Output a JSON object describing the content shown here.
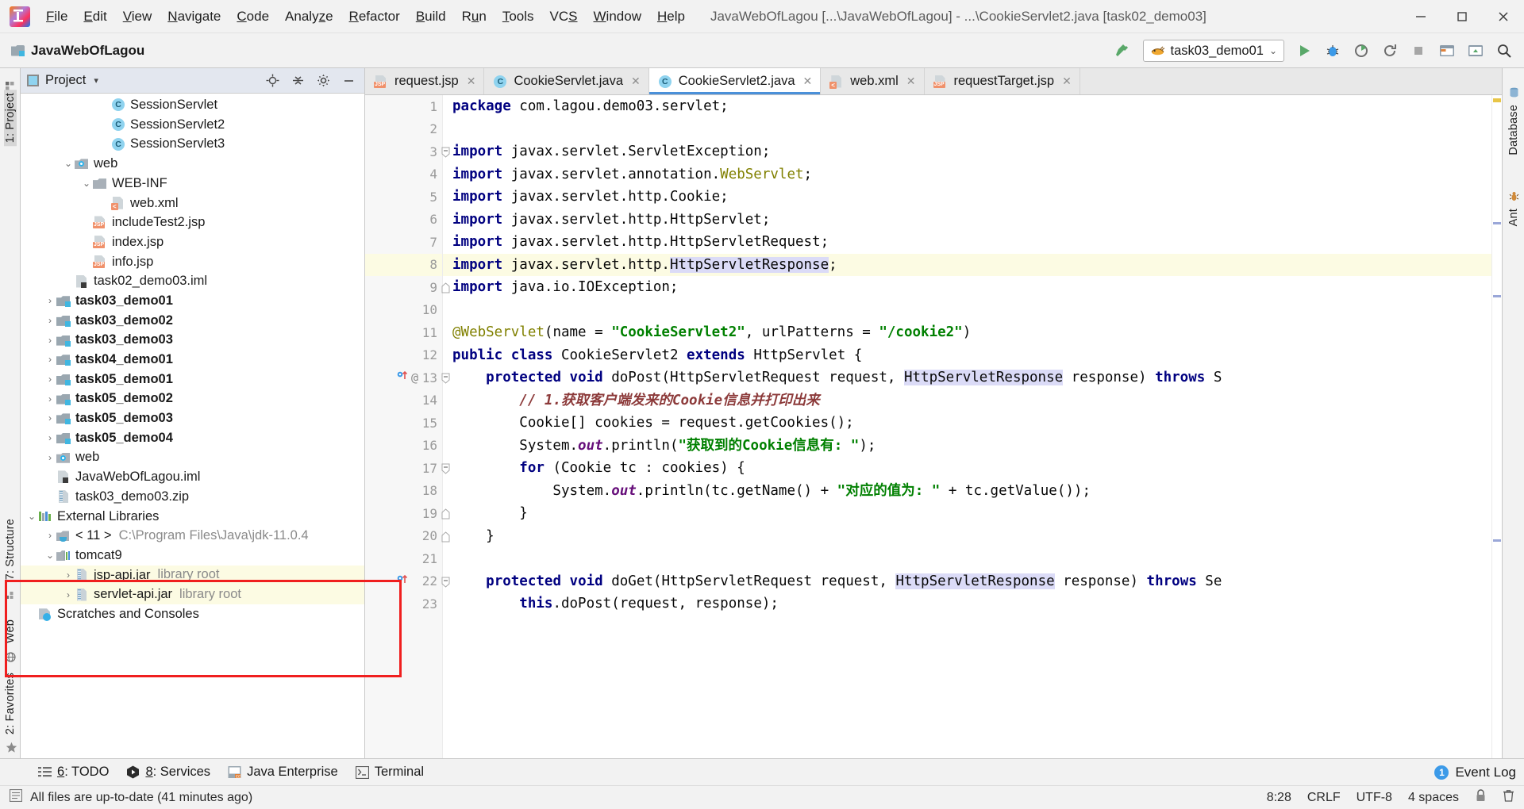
{
  "window": {
    "app_icon": "intellij-idea-logo",
    "title": "JavaWebOfLagou [...\\JavaWebOfLagou] - ...\\CookieServlet2.java [task02_demo03]",
    "minimize": "—",
    "maximize": "▢",
    "close": "✕"
  },
  "menubar": {
    "items": [
      {
        "label": "File",
        "mnemonic": "F"
      },
      {
        "label": "Edit",
        "mnemonic": "E"
      },
      {
        "label": "View",
        "mnemonic": "V"
      },
      {
        "label": "Navigate",
        "mnemonic": "N"
      },
      {
        "label": "Code",
        "mnemonic": "C"
      },
      {
        "label": "Analyze",
        "mnemonic": "z"
      },
      {
        "label": "Refactor",
        "mnemonic": "R"
      },
      {
        "label": "Build",
        "mnemonic": "B"
      },
      {
        "label": "Run",
        "mnemonic": "u"
      },
      {
        "label": "Tools",
        "mnemonic": "T"
      },
      {
        "label": "VCS",
        "mnemonic": "S"
      },
      {
        "label": "Window",
        "mnemonic": "W"
      },
      {
        "label": "Help",
        "mnemonic": "H"
      }
    ]
  },
  "navbar": {
    "breadcrumb": "JavaWebOfLagou",
    "run_config": {
      "label": "task03_demo01",
      "icon": "tomcat-icon",
      "chevron": "⌄"
    },
    "buttons": [
      {
        "name": "build-hammer",
        "icon": "hammer-icon"
      },
      {
        "name": "run",
        "icon": "run-triangle-icon"
      },
      {
        "name": "debug",
        "icon": "debug-bug-icon"
      },
      {
        "name": "run-coverage",
        "icon": "coverage-icon"
      },
      {
        "name": "rerun",
        "icon": "rerun-icon"
      },
      {
        "name": "stop",
        "icon": "stop-square-icon"
      },
      {
        "name": "open-in-browser",
        "icon": "browser-icon"
      },
      {
        "name": "update-app",
        "icon": "update-icon"
      },
      {
        "name": "search-everywhere",
        "icon": "search-icon"
      }
    ]
  },
  "left_rail": {
    "items": [
      "1: Project",
      "7: Structure",
      "Web",
      "2: Favorites"
    ],
    "active": "1: Project",
    "favorites_star": "★"
  },
  "right_rail": {
    "items": [
      "Database",
      "Ant"
    ]
  },
  "project_panel": {
    "title": "Project",
    "title_chevron": "▾",
    "header_buttons": [
      {
        "name": "locate-file-icon",
        "glyph": "⊕"
      },
      {
        "name": "collapse-all-icon",
        "glyph": "⇥"
      },
      {
        "name": "settings-gear-icon",
        "glyph": "⚙"
      },
      {
        "name": "hide-panel-icon",
        "glyph": "—"
      }
    ],
    "tree": [
      {
        "indent": 4,
        "arrow": "",
        "icon": "java-class-icon",
        "label": "SessionServlet",
        "sub": "",
        "bold": false,
        "highlight": false
      },
      {
        "indent": 4,
        "arrow": "",
        "icon": "java-class-icon",
        "label": "SessionServlet2",
        "sub": "",
        "bold": false,
        "highlight": false
      },
      {
        "indent": 4,
        "arrow": "",
        "icon": "java-class-icon",
        "label": "SessionServlet3",
        "sub": "",
        "bold": false,
        "highlight": false
      },
      {
        "indent": 2,
        "arrow": "⌄",
        "icon": "web-folder-icon",
        "label": "web",
        "sub": "",
        "bold": false,
        "highlight": false
      },
      {
        "indent": 3,
        "arrow": "⌄",
        "icon": "folder-icon",
        "label": "WEB-INF",
        "sub": "",
        "bold": false,
        "highlight": false
      },
      {
        "indent": 4,
        "arrow": "",
        "icon": "xml-file-icon",
        "label": "web.xml",
        "sub": "",
        "bold": false,
        "highlight": false
      },
      {
        "indent": 3,
        "arrow": "",
        "icon": "jsp-file-icon",
        "label": "includeTest2.jsp",
        "sub": "",
        "bold": false,
        "highlight": false
      },
      {
        "indent": 3,
        "arrow": "",
        "icon": "jsp-file-icon",
        "label": "index.jsp",
        "sub": "",
        "bold": false,
        "highlight": false
      },
      {
        "indent": 3,
        "arrow": "",
        "icon": "jsp-file-icon",
        "label": "info.jsp",
        "sub": "",
        "bold": false,
        "highlight": false
      },
      {
        "indent": 2,
        "arrow": "",
        "icon": "iml-file-icon",
        "label": "task02_demo03.iml",
        "sub": "",
        "bold": false,
        "highlight": false
      },
      {
        "indent": 1,
        "arrow": "›",
        "icon": "module-folder-icon",
        "label": "task03_demo01",
        "sub": "",
        "bold": true,
        "highlight": false
      },
      {
        "indent": 1,
        "arrow": "›",
        "icon": "module-folder-icon",
        "label": "task03_demo02",
        "sub": "",
        "bold": true,
        "highlight": false
      },
      {
        "indent": 1,
        "arrow": "›",
        "icon": "module-folder-icon",
        "label": "task03_demo03",
        "sub": "",
        "bold": true,
        "highlight": false
      },
      {
        "indent": 1,
        "arrow": "›",
        "icon": "module-folder-icon",
        "label": "task04_demo01",
        "sub": "",
        "bold": true,
        "highlight": false
      },
      {
        "indent": 1,
        "arrow": "›",
        "icon": "module-folder-icon",
        "label": "task05_demo01",
        "sub": "",
        "bold": true,
        "highlight": false
      },
      {
        "indent": 1,
        "arrow": "›",
        "icon": "module-folder-icon",
        "label": "task05_demo02",
        "sub": "",
        "bold": true,
        "highlight": false
      },
      {
        "indent": 1,
        "arrow": "›",
        "icon": "module-folder-icon",
        "label": "task05_demo03",
        "sub": "",
        "bold": true,
        "highlight": false
      },
      {
        "indent": 1,
        "arrow": "›",
        "icon": "module-folder-icon",
        "label": "task05_demo04",
        "sub": "",
        "bold": true,
        "highlight": false
      },
      {
        "indent": 1,
        "arrow": "›",
        "icon": "web-folder-icon",
        "label": "web",
        "sub": "",
        "bold": false,
        "highlight": false
      },
      {
        "indent": 1,
        "arrow": "",
        "icon": "iml-file-icon",
        "label": "JavaWebOfLagou.iml",
        "sub": "",
        "bold": false,
        "highlight": false
      },
      {
        "indent": 1,
        "arrow": "",
        "icon": "zip-file-icon",
        "label": "task03_demo03.zip",
        "sub": "",
        "bold": false,
        "highlight": false
      },
      {
        "indent": 0,
        "arrow": "⌄",
        "icon": "external-libraries-icon",
        "label": "External Libraries",
        "sub": "",
        "bold": false,
        "highlight": false
      },
      {
        "indent": 1,
        "arrow": "›",
        "icon": "jdk-icon",
        "label": "< 11 >",
        "sub": "C:\\Program Files\\Java\\jdk-11.0.4",
        "bold": false,
        "highlight": false
      },
      {
        "indent": 1,
        "arrow": "⌄",
        "icon": "library-icon",
        "label": "tomcat9",
        "sub": "",
        "bold": false,
        "highlight": false
      },
      {
        "indent": 2,
        "arrow": "›",
        "icon": "jar-file-icon",
        "label": "jsp-api.jar",
        "sub": "library root",
        "bold": false,
        "highlight": true
      },
      {
        "indent": 2,
        "arrow": "›",
        "icon": "jar-file-icon",
        "label": "servlet-api.jar",
        "sub": "library root",
        "bold": false,
        "highlight": true
      },
      {
        "indent": 0,
        "arrow": "",
        "icon": "scratches-icon",
        "label": "Scratches and Consoles",
        "sub": "",
        "bold": false,
        "highlight": false
      }
    ],
    "annotation": {
      "name": "red-highlight-box",
      "color": "#f01f1f"
    }
  },
  "editor": {
    "tabs": [
      {
        "label": "request.jsp",
        "icon": "jsp-file-icon",
        "active": false,
        "close": "✕"
      },
      {
        "label": "CookieServlet.java",
        "icon": "java-class-icon",
        "active": false,
        "close": "✕"
      },
      {
        "label": "CookieServlet2.java",
        "icon": "java-class-icon",
        "active": true,
        "close": "✕"
      },
      {
        "label": "web.xml",
        "icon": "xml-file-icon",
        "active": false,
        "close": "✕"
      },
      {
        "label": "requestTarget.jsp",
        "icon": "jsp-file-icon",
        "active": false,
        "close": "✕"
      }
    ],
    "lines": [
      {
        "n": 1,
        "html": "<span class='kw'>package</span> com.lagou.demo03.servlet;",
        "fold": false,
        "hl": false,
        "gutter_icons": ""
      },
      {
        "n": 2,
        "html": "",
        "fold": false,
        "hl": false,
        "gutter_icons": ""
      },
      {
        "n": 3,
        "html": "<span class='kw'>import</span> javax.servlet.ServletException;",
        "fold": "top",
        "hl": false,
        "gutter_icons": ""
      },
      {
        "n": 4,
        "html": "<span class='kw'>import</span> javax.servlet.annotation.<span class='ann'>WebServlet</span>;",
        "fold": false,
        "hl": false,
        "gutter_icons": ""
      },
      {
        "n": 5,
        "html": "<span class='kw'>import</span> javax.servlet.http.Cookie;",
        "fold": false,
        "hl": false,
        "gutter_icons": ""
      },
      {
        "n": 6,
        "html": "<span class='kw'>import</span> javax.servlet.http.HttpServlet;",
        "fold": false,
        "hl": false,
        "gutter_icons": ""
      },
      {
        "n": 7,
        "html": "<span class='kw'>import</span> javax.servlet.http.HttpServletRequest;",
        "fold": false,
        "hl": false,
        "gutter_icons": ""
      },
      {
        "n": 8,
        "html": "<span class='kw'>import</span> javax.servlet.http.<span class='hlid'>HttpServletResponse</span>;",
        "fold": false,
        "hl": true,
        "gutter_icons": ""
      },
      {
        "n": 9,
        "html": "<span class='kw'>import</span> java.io.IOException;",
        "fold": "bottom",
        "hl": false,
        "gutter_icons": ""
      },
      {
        "n": 10,
        "html": "",
        "fold": false,
        "hl": false,
        "gutter_icons": ""
      },
      {
        "n": 11,
        "html": "<span class='ann'>@WebServlet</span>(name = <span class='str'>\"CookieServlet2\"</span>, urlPatterns = <span class='str'>\"/cookie2\"</span>)",
        "fold": false,
        "hl": false,
        "gutter_icons": ""
      },
      {
        "n": 12,
        "html": "<span class='kw'>public</span> <span class='kw'>class</span> CookieServlet2 <span class='kw'>extends</span> HttpServlet {",
        "fold": false,
        "hl": false,
        "gutter_icons": ""
      },
      {
        "n": 13,
        "html": "    <span class='kw'>protected</span> <span class='kw'>void</span> doPost(HttpServletRequest request, <span class='hlid'>HttpServletResponse</span> response) <span class='kw'>throws</span> S",
        "fold": "top",
        "hl": false,
        "gutter_icons": "override-up,at"
      },
      {
        "n": 14,
        "html": "        <span class='cmt'>// 1.获取客户端发来的Cookie信息并打印出来</span>",
        "fold": false,
        "hl": false,
        "gutter_icons": ""
      },
      {
        "n": 15,
        "html": "        Cookie[] cookies = request.getCookies();",
        "fold": false,
        "hl": false,
        "gutter_icons": ""
      },
      {
        "n": 16,
        "html": "        System.<span class='fld'>out</span>.println(<span class='str'>\"获取到的Cookie信息有: \"</span>);",
        "fold": false,
        "hl": false,
        "gutter_icons": ""
      },
      {
        "n": 17,
        "html": "        <span class='kw'>for</span> (Cookie tc : cookies) {",
        "fold": "top",
        "hl": false,
        "gutter_icons": ""
      },
      {
        "n": 18,
        "html": "            System.<span class='fld'>out</span>.println(tc.getName() + <span class='str'>\"对应的值为: \"</span> + tc.getValue());",
        "fold": false,
        "hl": false,
        "gutter_icons": ""
      },
      {
        "n": 19,
        "html": "        }",
        "fold": "bottom",
        "hl": false,
        "gutter_icons": ""
      },
      {
        "n": 20,
        "html": "    }",
        "fold": "bottom",
        "hl": false,
        "gutter_icons": ""
      },
      {
        "n": 21,
        "html": "",
        "fold": false,
        "hl": false,
        "gutter_icons": ""
      },
      {
        "n": 22,
        "html": "    <span class='kw'>protected</span> <span class='kw'>void</span> doGet(HttpServletRequest request, <span class='hlid'>HttpServletResponse</span> response) <span class='kw'>throws</span> Se",
        "fold": "top",
        "hl": false,
        "gutter_icons": "override-up"
      },
      {
        "n": 23,
        "html": "        <span class='kw'>this</span>.doPost(request, response);",
        "fold": false,
        "hl": false,
        "gutter_icons": ""
      }
    ]
  },
  "tool_window_bar": {
    "items": [
      {
        "label": "6: TODO",
        "mnemonic": "6",
        "icon": "todo-list-icon"
      },
      {
        "label": "8: Services",
        "mnemonic": "8",
        "icon": "services-play-icon"
      },
      {
        "label": "Java Enterprise",
        "mnemonic": "",
        "icon": "java-enterprise-icon"
      },
      {
        "label": "Terminal",
        "mnemonic": "",
        "icon": "terminal-icon"
      }
    ],
    "event_log": {
      "label": "Event Log",
      "badge": "1"
    }
  },
  "statusbar": {
    "message": "All files are up-to-date (41 minutes ago)",
    "position": "8:28",
    "line_separator": "CRLF",
    "encoding": "UTF-8",
    "indent": "4 spaces",
    "lock_icon": "lock-icon",
    "trash_icon": "trash-icon"
  }
}
